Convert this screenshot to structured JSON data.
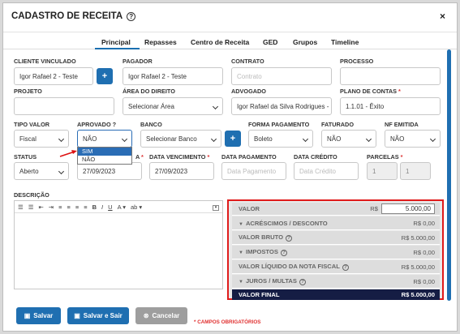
{
  "modal": {
    "title": "CADASTRO DE RECEITA",
    "close": "×"
  },
  "tabs": [
    "Principal",
    "Repasses",
    "Centro de Receita",
    "GED",
    "Grupos",
    "Timeline"
  ],
  "fields": {
    "cliente": {
      "label": "CLIENTE VINCULADO",
      "value": "Igor Rafael 2 - Teste"
    },
    "pagador": {
      "label": "PAGADOR",
      "value": "Igor Rafael 2 - Teste"
    },
    "contrato": {
      "label": "CONTRATO",
      "placeholder": "Contrato"
    },
    "processo": {
      "label": "PROCESSO",
      "value": ""
    },
    "projeto": {
      "label": "PROJETO",
      "value": ""
    },
    "area": {
      "label": "ÁREA DO DIREITO",
      "value": "Selecionar Área"
    },
    "advogado": {
      "label": "ADVOGADO",
      "value": "Igor Rafael da Silva Rodrigues -"
    },
    "plano": {
      "label": "PLANO DE CONTAS",
      "value": "1.1.01 - Êxito"
    },
    "tipo_valor": {
      "label": "TIPO VALOR",
      "value": "Fiscal"
    },
    "aprovado": {
      "label": "APROVADO ?",
      "value": "NÃO",
      "options": [
        "SIM",
        "NÃO"
      ]
    },
    "banco": {
      "label": "BANCO",
      "value": "Selecionar Banco"
    },
    "forma_pag": {
      "label": "FORMA PAGAMENTO",
      "value": "Boleto"
    },
    "faturado": {
      "label": "FATURADO",
      "value": "NÃO"
    },
    "nf": {
      "label": "NF EMITIDA",
      "value": "NÃO"
    },
    "status": {
      "label": "STATUS",
      "value": "Aberto"
    },
    "data_comp": {
      "label": "A",
      "value": "27/09/2023"
    },
    "data_venc": {
      "label": "DATA VENCIMENTO",
      "value": "27/09/2023"
    },
    "data_pag": {
      "label": "DATA PAGAMENTO",
      "placeholder": "Data Pagamento"
    },
    "data_cred": {
      "label": "DATA CRÉDITO",
      "placeholder": "Data Crédito"
    },
    "parcelas": {
      "label": "PARCELAS",
      "value1": "1",
      "value2": "1"
    },
    "descricao": {
      "label": "DESCRIÇÃO"
    }
  },
  "toolbar": [
    "☰",
    "☰",
    "⇤",
    "⇥",
    "≡",
    "≡",
    "≡",
    "≡",
    "B",
    "I",
    "U",
    "A ▾",
    "ab ▾"
  ],
  "summary": {
    "valor_label": "VALOR",
    "currency": "R$",
    "valor": "5.000,00",
    "rows": [
      {
        "label": "ACRÉSCIMOS / DESCONTO",
        "value": "R$ 0,00"
      },
      {
        "label": "VALOR BRUTO",
        "value": "R$ 5.000,00"
      },
      {
        "label": "IMPOSTOS",
        "value": "R$ 0,00"
      },
      {
        "label": "VALOR LÍQUIDO DA NOTA FISCAL",
        "value": "R$ 5.000,00"
      },
      {
        "label": "JUROS / MULTAS",
        "value": "R$ 0,00"
      },
      {
        "label": "VALOR FINAL",
        "value": "R$ 5.000,00"
      }
    ]
  },
  "actions": {
    "save": "Salvar",
    "save_exit": "Salvar e Sair",
    "cancel": "Cancelar",
    "required_note": "* CAMPOS OBRIGATÓRIOS"
  },
  "colors": {
    "primary": "#1f6fb1",
    "highlight": "#e01b1b",
    "final_bg": "#151d44"
  }
}
